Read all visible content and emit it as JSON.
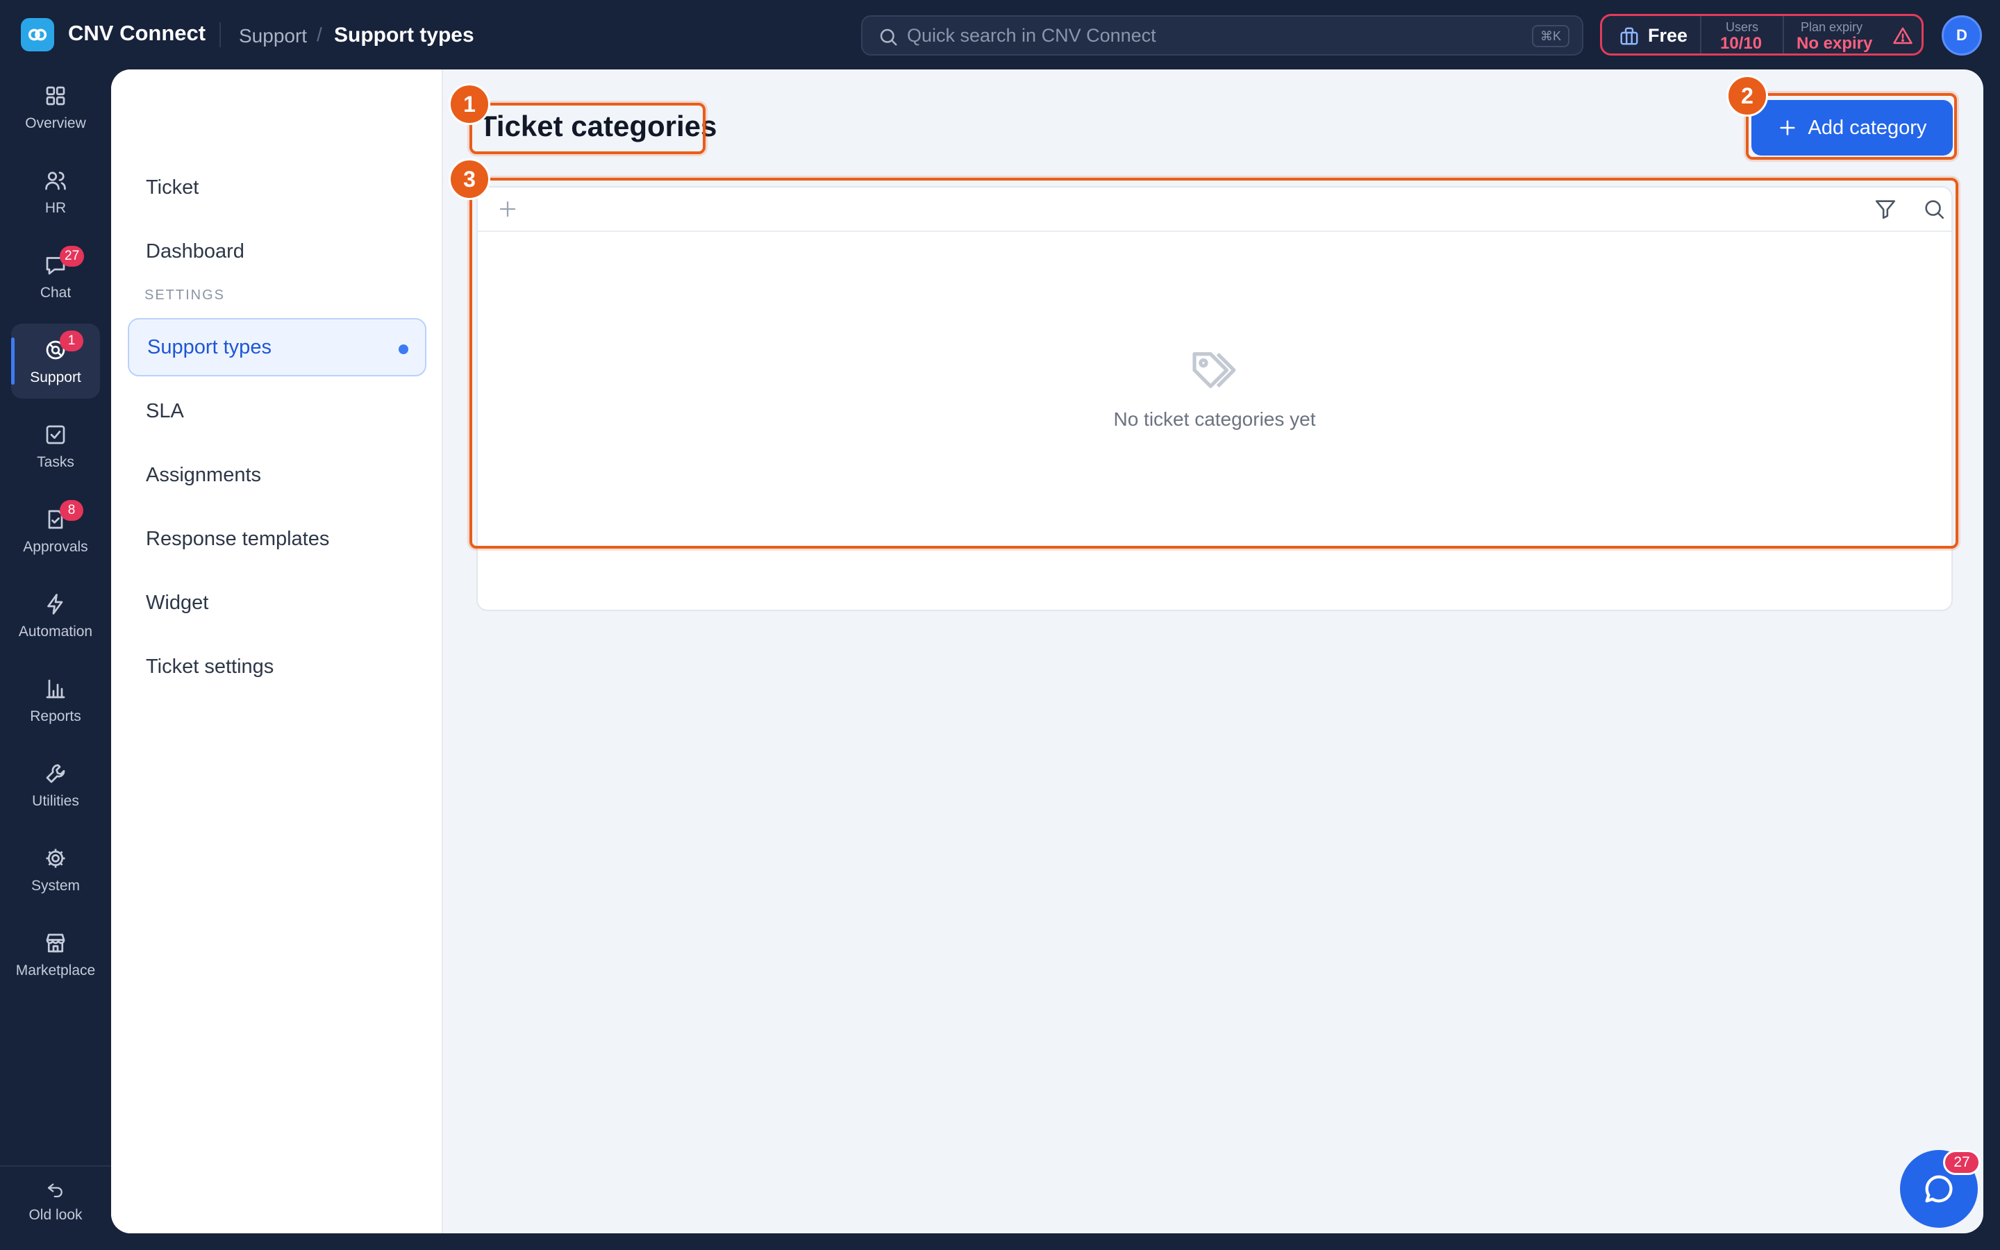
{
  "app": {
    "title": "CNV Connect"
  },
  "breadcrumb": {
    "parent": "Support",
    "separator": "/",
    "current": "Support types"
  },
  "search": {
    "placeholder": "Quick search in CNV Connect",
    "shortcut": "⌘K"
  },
  "plan": {
    "name": "Free",
    "users_label": "Users",
    "users_value": "10/10",
    "expiry_label": "Plan expiry",
    "expiry_value": "No expiry"
  },
  "user": {
    "initial": "D"
  },
  "rail": {
    "items": [
      {
        "label": "Overview",
        "icon": "grid-icon"
      },
      {
        "label": "HR",
        "icon": "users-icon"
      },
      {
        "label": "Chat",
        "icon": "chat-icon",
        "badge": "27"
      },
      {
        "label": "Support",
        "icon": "support-icon",
        "badge": "1",
        "active": true
      },
      {
        "label": "Tasks",
        "icon": "task-check-icon"
      },
      {
        "label": "Approvals",
        "icon": "approvals-icon",
        "badge": "8"
      },
      {
        "label": "Automation",
        "icon": "lightning-icon"
      },
      {
        "label": "Reports",
        "icon": "bar-chart-icon"
      },
      {
        "label": "Utilities",
        "icon": "wrench-icon"
      },
      {
        "label": "System",
        "icon": "gear-icon"
      },
      {
        "label": "Marketplace",
        "icon": "store-icon"
      }
    ],
    "old_look": "Old look"
  },
  "subnav": {
    "items_top": [
      "Ticket",
      "Dashboard"
    ],
    "section_heading": "SETTINGS",
    "items_settings": [
      "Support types",
      "SLA",
      "Assignments",
      "Response templates",
      "Widget",
      "Ticket settings"
    ],
    "active": "Support types"
  },
  "main": {
    "title": "Ticket categories",
    "add_button": "Add category",
    "empty_state": "No ticket categories yet"
  },
  "annotations": [
    "1",
    "2",
    "3"
  ],
  "chat_fab": {
    "badge": "27"
  },
  "colors": {
    "background": "#17223b",
    "accent": "#2466ea",
    "badge": "#e5355b",
    "annotation": "#e85d1a"
  }
}
